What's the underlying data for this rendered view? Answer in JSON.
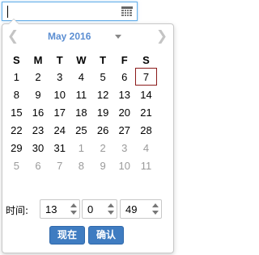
{
  "input": {
    "value": ""
  },
  "picker": {
    "prev_icon": "chevron-left-icon",
    "next_icon": "chevron-right-icon",
    "month_title": "May 2016",
    "weekdays": [
      "S",
      "M",
      "T",
      "W",
      "T",
      "F",
      "S"
    ],
    "weeks": [
      [
        {
          "d": "1"
        },
        {
          "d": "2"
        },
        {
          "d": "3"
        },
        {
          "d": "4"
        },
        {
          "d": "5"
        },
        {
          "d": "6"
        },
        {
          "d": "7",
          "selected": true
        }
      ],
      [
        {
          "d": "8"
        },
        {
          "d": "9"
        },
        {
          "d": "10"
        },
        {
          "d": "11"
        },
        {
          "d": "12"
        },
        {
          "d": "13"
        },
        {
          "d": "14"
        }
      ],
      [
        {
          "d": "15"
        },
        {
          "d": "16"
        },
        {
          "d": "17"
        },
        {
          "d": "18"
        },
        {
          "d": "19"
        },
        {
          "d": "20"
        },
        {
          "d": "21"
        }
      ],
      [
        {
          "d": "22"
        },
        {
          "d": "23"
        },
        {
          "d": "24"
        },
        {
          "d": "25"
        },
        {
          "d": "26"
        },
        {
          "d": "27"
        },
        {
          "d": "28"
        }
      ],
      [
        {
          "d": "29"
        },
        {
          "d": "30"
        },
        {
          "d": "31"
        },
        {
          "d": "1",
          "muted": true
        },
        {
          "d": "2",
          "muted": true
        },
        {
          "d": "3",
          "muted": true
        },
        {
          "d": "4",
          "muted": true
        }
      ],
      [
        {
          "d": "5",
          "muted": true
        },
        {
          "d": "6",
          "muted": true
        },
        {
          "d": "7",
          "muted": true
        },
        {
          "d": "8",
          "muted": true
        },
        {
          "d": "9",
          "muted": true
        },
        {
          "d": "10",
          "muted": true
        },
        {
          "d": "11",
          "muted": true
        }
      ]
    ],
    "time": {
      "label": "时间:",
      "hour": "13",
      "minute": "0",
      "second": "49"
    },
    "buttons": {
      "now": "现在",
      "confirm": "确认"
    },
    "colors": {
      "accent": "#3f7cc1",
      "title": "#5b8ed2",
      "selected_border": "#8b1a1a",
      "muted_text": "#9a9a9a"
    }
  }
}
